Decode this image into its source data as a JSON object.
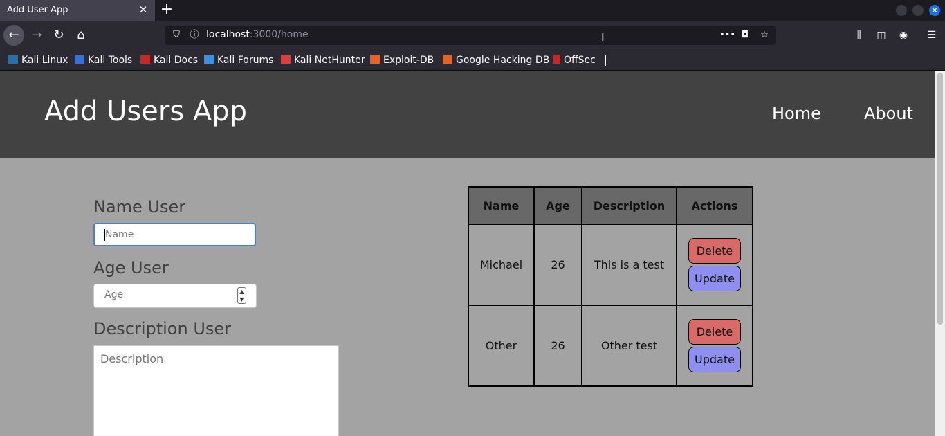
{
  "browser": {
    "tab_title": "Add User App",
    "tab_close": "✕",
    "new_tab": "+",
    "url_host": "localhost",
    "url_path": ":3000/home",
    "bookmarks": [
      "Kali Linux",
      "Kali Tools",
      "Kali Docs",
      "Kali Forums",
      "Kali NetHunter",
      "Exploit-DB",
      "Google Hacking DB",
      "OffSec"
    ]
  },
  "header": {
    "title": "Add Users App",
    "nav": [
      "Home",
      "About"
    ]
  },
  "form": {
    "name_label": "Name User",
    "name_placeholder": "Name",
    "age_label": "Age User",
    "age_placeholder": "Age",
    "description_label": "Description User",
    "description_placeholder": "Description"
  },
  "table": {
    "headers": [
      "Name",
      "Age",
      "Description",
      "Actions"
    ],
    "rows": [
      {
        "name": "Michael",
        "age": "26",
        "description": "This is a test"
      },
      {
        "name": "Other",
        "age": "26",
        "description": "Other test"
      }
    ],
    "delete_label": "Delete",
    "update_label": "Update"
  },
  "colors": {
    "header_bg": "#424242",
    "page_bg": "#a3a3a3",
    "delete_btn": "#d86a6a",
    "update_btn": "#8f8ff0"
  }
}
